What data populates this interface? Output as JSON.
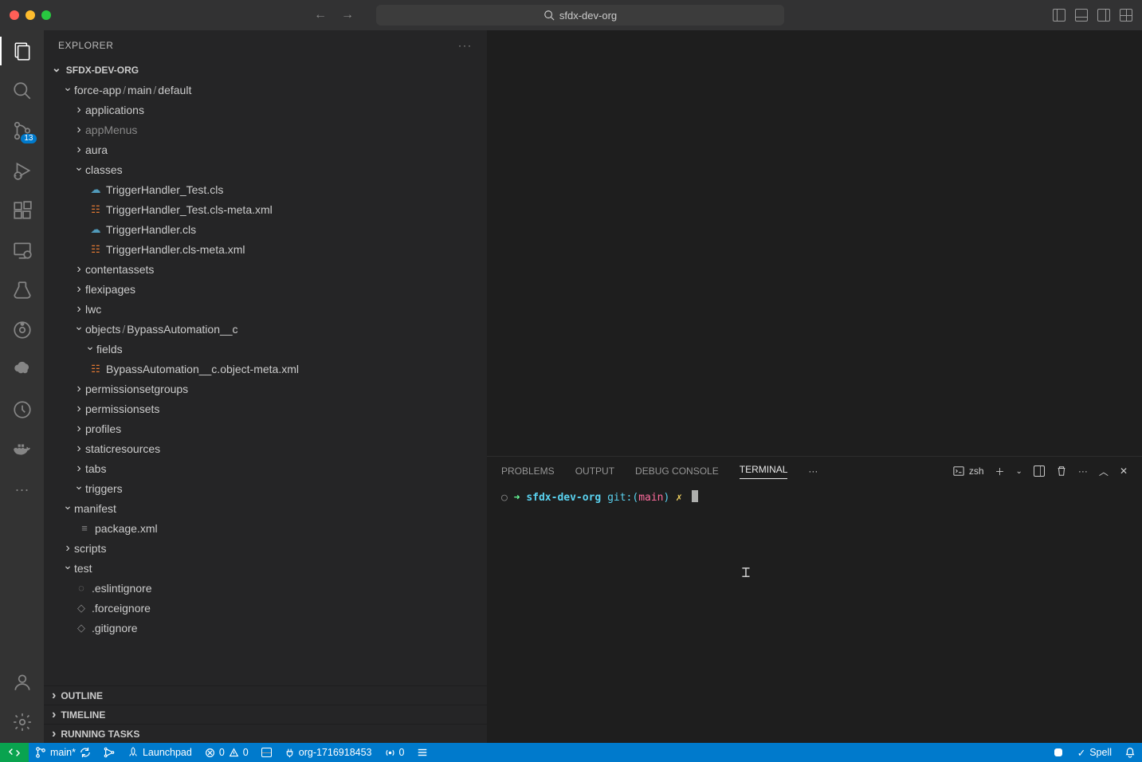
{
  "titlebar": {
    "search": "sfdx-dev-org"
  },
  "activity": {
    "scm_badge": "13"
  },
  "sidebar": {
    "header": "EXPLORER",
    "project": "SFDX-DEV-ORG",
    "path": {
      "a": "force-app",
      "b": "main",
      "c": "default"
    },
    "items": {
      "applications": "applications",
      "appMenus": "appMenus",
      "aura": "aura",
      "classes": "classes",
      "th_test_cls": "TriggerHandler_Test.cls",
      "th_test_meta": "TriggerHandler_Test.cls-meta.xml",
      "th_cls": "TriggerHandler.cls",
      "th_meta": "TriggerHandler.cls-meta.xml",
      "contentassets": "contentassets",
      "flexipages": "flexipages",
      "lwc": "lwc",
      "objects_a": "objects",
      "objects_b": "BypassAutomation__c",
      "fields": "fields",
      "bypass_meta": "BypassAutomation__c.object-meta.xml",
      "permsetgroups": "permissionsetgroups",
      "permsets": "permissionsets",
      "profiles": "profiles",
      "staticresources": "staticresources",
      "tabs": "tabs",
      "triggers": "triggers",
      "manifest": "manifest",
      "package_xml": "package.xml",
      "scripts": "scripts",
      "test": "test",
      "eslintignore": ".eslintignore",
      "forceignore": ".forceignore",
      "gitignore": ".gitignore"
    },
    "sections": {
      "outline": "OUTLINE",
      "timeline": "TIMELINE",
      "running": "RUNNING TASKS"
    }
  },
  "panel": {
    "tabs": {
      "problems": "PROBLEMS",
      "output": "OUTPUT",
      "debug": "DEBUG CONSOLE",
      "terminal": "TERMINAL"
    },
    "shell": "zsh",
    "prompt": {
      "path": "sfdx-dev-org",
      "git": "git:(",
      "branch": "main",
      "close": ")",
      "dirty": "✗"
    }
  },
  "status": {
    "branch": "main*",
    "launchpad": "Launchpad",
    "err": "0",
    "warn": "0",
    "org": "org-1716918453",
    "signal": "0",
    "spell": "Spell"
  }
}
